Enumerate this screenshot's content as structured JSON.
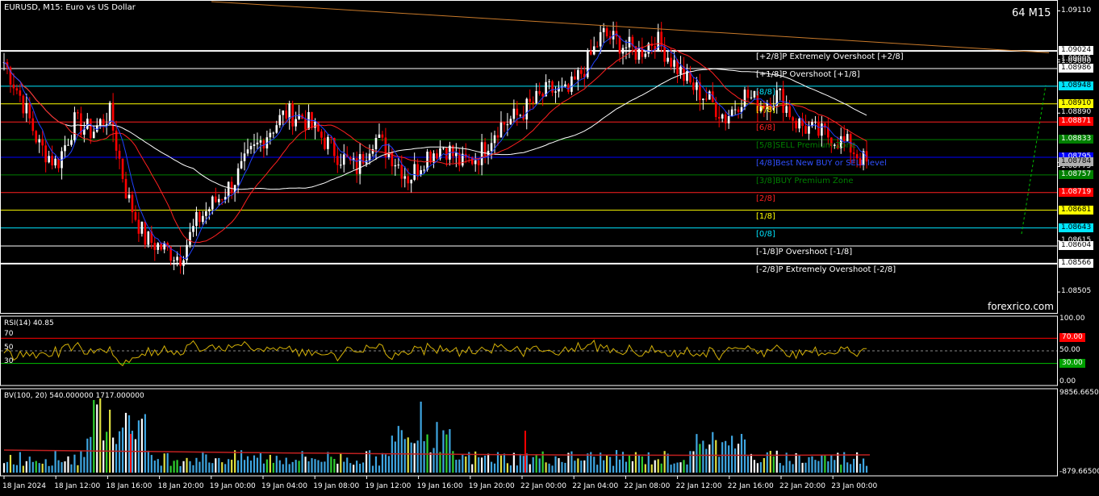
{
  "header": {
    "symbol": "EURUSD",
    "timeframe": "M15",
    "description": "Euro vs US Dollar",
    "title": "EURUSD, M15:  Euro vs US Dollar"
  },
  "badge": "64 M15",
  "watermark": "forexrico.com",
  "price_axis": {
    "ticks": [
      "1.09110",
      "1.09005",
      "1.09000",
      "1.08890",
      "1.08784",
      "1.08775",
      "1.08615",
      "1.08505"
    ],
    "range": [
      1.0846,
      1.0913
    ]
  },
  "murrey_levels": [
    {
      "label": "[+2/8]P Extremely Overshoot [+2/8]",
      "price": 1.09024,
      "value": "1.09024",
      "color": "#ffffff",
      "tag_bg": "#ffffff",
      "tag_fg": "#000000"
    },
    {
      "label": "[+1/8]P Overshoot [+1/8]",
      "price": 1.08986,
      "value": "1.08986",
      "color": "#ffffff",
      "tag_bg": "#ffffff",
      "tag_fg": "#000000"
    },
    {
      "label": "[8/8]",
      "price": 1.08948,
      "value": "1.08948",
      "color": "#00e5ff",
      "tag_bg": "#00e5ff",
      "tag_fg": "#000000"
    },
    {
      "label": "[7/8]",
      "price": 1.0891,
      "value": "1.08910",
      "color": "#ffff00",
      "tag_bg": "#ffff00",
      "tag_fg": "#000000"
    },
    {
      "label": "[6/8]",
      "price": 1.08871,
      "value": "1.08871",
      "color": "#ff2020",
      "tag_bg": "#ff0000",
      "tag_fg": "#ffffff"
    },
    {
      "label": "[5/8]SELL Premium Zone",
      "price": 1.08833,
      "value": "1.08833",
      "color": "#008000",
      "tag_bg": "#008000",
      "tag_fg": "#ffffff"
    },
    {
      "label": "[4/8]Best New BUY or SELL level",
      "price": 1.08795,
      "value": "1.08795",
      "color": "#0000ff",
      "tag_bg": "#0000ff",
      "tag_fg": "#ffffff"
    },
    {
      "label": "[3/8]BUY Premium Zone",
      "price": 1.08757,
      "value": "1.08757",
      "color": "#008000",
      "tag_bg": "#008000",
      "tag_fg": "#ffffff"
    },
    {
      "label": "[2/8]",
      "price": 1.08719,
      "value": "1.08719",
      "color": "#ff2020",
      "tag_bg": "#ff0000",
      "tag_fg": "#ffffff"
    },
    {
      "label": "[1/8]",
      "price": 1.08681,
      "value": "1.08681",
      "color": "#ffff00",
      "tag_bg": "#ffff00",
      "tag_fg": "#000000"
    },
    {
      "label": "[0/8]",
      "price": 1.08643,
      "value": "1.08643",
      "color": "#00e5ff",
      "tag_bg": "#00e5ff",
      "tag_fg": "#000000"
    },
    {
      "label": "[-1/8]P Overshoot [-1/8]",
      "price": 1.08604,
      "value": "1.08604",
      "color": "#ffffff",
      "tag_bg": "#ffffff",
      "tag_fg": "#000000"
    },
    {
      "label": "[-2/8]P Extremely Overshoot [-2/8]",
      "price": 1.08566,
      "value": "1.08566",
      "color": "#ffffff",
      "tag_bg": "#ffffff",
      "tag_fg": "#000000"
    }
  ],
  "current_price": {
    "value": "1.08784",
    "price": 1.08784
  },
  "rsi": {
    "title": "RSI(14) 40.85",
    "level_labels": [
      "70",
      "50",
      "30"
    ],
    "axis": [
      "100.00",
      "70.00",
      "50.00",
      "30.00",
      "0.00"
    ],
    "colors": {
      "line": "#d4b106",
      "upper": "#ff0000",
      "lower": "#00c000"
    }
  },
  "bv": {
    "title": "BV(100, 20) 540.000000 1717.000000",
    "axis": [
      "9856.665000",
      "-879.665000"
    ]
  },
  "time_axis": [
    "18 Jan 2024",
    "18 Jan 12:00",
    "18 Jan 16:00",
    "18 Jan 20:00",
    "19 Jan 00:00",
    "19 Jan 04:00",
    "19 Jan 08:00",
    "19 Jan 12:00",
    "19 Jan 16:00",
    "19 Jan 20:00",
    "22 Jan 00:00",
    "22 Jan 04:00",
    "22 Jan 08:00",
    "22 Jan 12:00",
    "22 Jan 16:00",
    "22 Jan 20:00",
    "23 Jan 00:00"
  ],
  "chart_data": {
    "type": "candlestick",
    "title": "EURUSD, M15:  Euro vs US Dollar",
    "ylim": [
      1.0846,
      1.0913
    ],
    "x": [
      "18 Jan 2024",
      "18 Jan 12:00",
      "18 Jan 16:00",
      "18 Jan 20:00",
      "19 Jan 00:00",
      "19 Jan 04:00",
      "19 Jan 08:00",
      "19 Jan 12:00",
      "19 Jan 16:00",
      "19 Jan 20:00",
      "22 Jan 00:00",
      "22 Jan 04:00",
      "22 Jan 08:00",
      "22 Jan 12:00",
      "22 Jan 16:00",
      "22 Jan 20:00",
      "23 Jan 00:00"
    ],
    "close_path": [
      1.09,
      1.0892,
      1.0882,
      1.0878,
      1.0887,
      1.0885,
      1.0889,
      1.0871,
      1.0862,
      1.086,
      1.0858,
      1.0866,
      1.087,
      1.0874,
      1.088,
      1.0885,
      1.0889,
      1.0888,
      1.0884,
      1.088,
      1.0877,
      1.0884,
      1.088,
      1.0875,
      1.088,
      1.0882,
      1.0878,
      1.088,
      1.0886,
      1.0888,
      1.0891,
      1.0894,
      1.0893,
      1.0899,
      1.0906,
      1.0904,
      1.0902,
      1.0905,
      1.09,
      1.0895,
      1.0892,
      1.0888,
      1.0893,
      1.0891,
      1.0893,
      1.0887,
      1.0885,
      1.0884,
      1.0882,
      1.0878
    ],
    "series": [
      {
        "name": "MA slow",
        "color": "#ffffff"
      },
      {
        "name": "MA medium",
        "color": "#ff2020"
      },
      {
        "name": "MA fast",
        "color": "#2040ff"
      }
    ]
  }
}
